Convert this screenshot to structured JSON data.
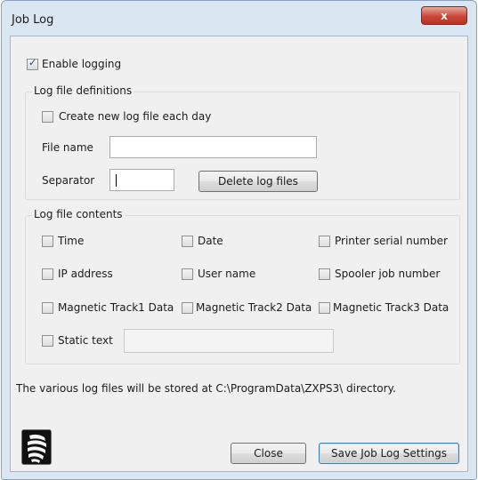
{
  "window": {
    "title": "Job Log",
    "close_glyph": "x"
  },
  "enable_logging": {
    "label": "Enable logging",
    "checked": true
  },
  "definitions": {
    "title": "Log file definitions",
    "create_new_each_day": {
      "label": "Create new log file each day",
      "checked": false
    },
    "file_name": {
      "label": "File name",
      "value": ""
    },
    "separator": {
      "label": "Separator",
      "value": ""
    },
    "delete_button": "Delete log files"
  },
  "contents": {
    "title": "Log file contents",
    "items": [
      {
        "label": "Time",
        "checked": false
      },
      {
        "label": "Date",
        "checked": false
      },
      {
        "label": "Printer serial number",
        "checked": false
      },
      {
        "label": "IP address",
        "checked": false
      },
      {
        "label": "User name",
        "checked": false
      },
      {
        "label": "Spooler job number",
        "checked": false
      },
      {
        "label": "Magnetic Track1 Data",
        "checked": false
      },
      {
        "label": "Magnetic Track2 Data",
        "checked": false
      },
      {
        "label": "Magnetic Track3 Data",
        "checked": false
      }
    ],
    "static_text": {
      "label": "Static text",
      "checked": false,
      "value": ""
    }
  },
  "info_text": "The various log files will be stored at C:\\ProgramData\\ZXPS3\\ directory.",
  "buttons": {
    "close": "Close",
    "save": "Save Job Log Settings"
  },
  "icons": {
    "logo": "zebra-logo-icon",
    "close": "close-icon"
  }
}
